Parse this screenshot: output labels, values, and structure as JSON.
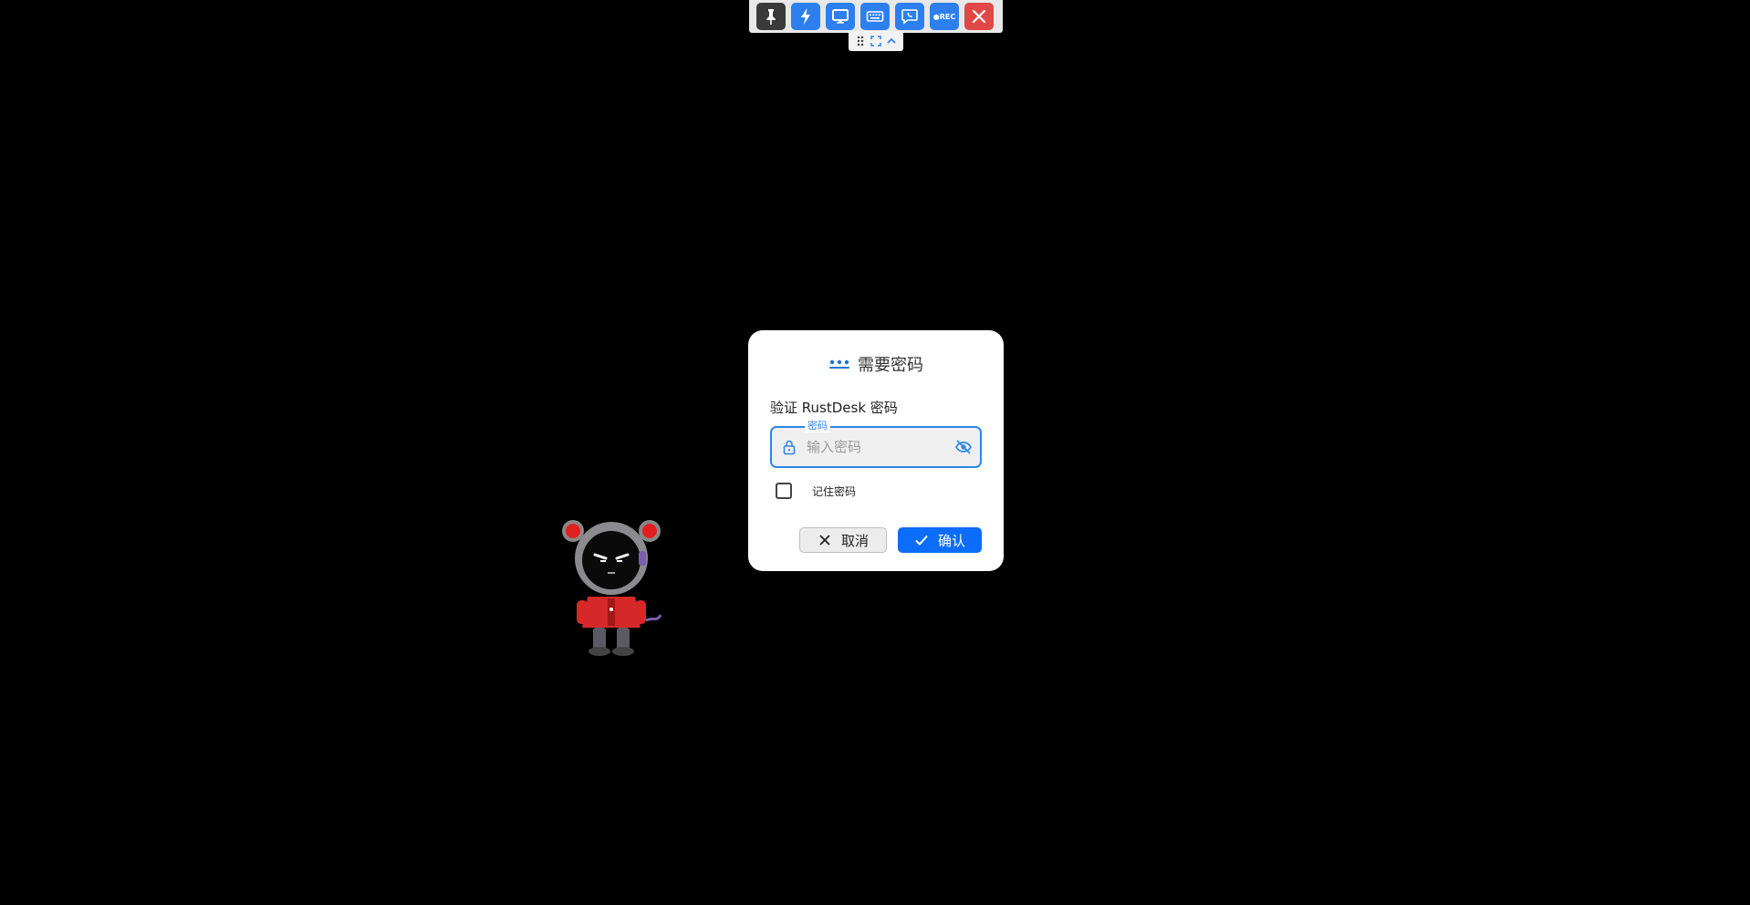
{
  "toolbar": {
    "buttons": [
      {
        "icon": "pin-icon",
        "color": "#3a3a3a"
      },
      {
        "icon": "lightning-icon",
        "color": "#2d7ff0"
      },
      {
        "icon": "monitor-icon",
        "color": "#2d7ff0"
      },
      {
        "icon": "keyboard-icon",
        "color": "#2d7ff0"
      },
      {
        "icon": "chat-icon",
        "color": "#2d7ff0"
      },
      {
        "icon": "record-icon",
        "color": "#2d7ff0"
      },
      {
        "icon": "close-icon",
        "color": "#e04848"
      }
    ],
    "rec_label": "●REC"
  },
  "subbar": {
    "icons": [
      "drag-handle-icon",
      "fullscreen-icon",
      "collapse-icon"
    ]
  },
  "dialog": {
    "title": "需要密码",
    "title_icon": "password-dots-icon",
    "subtitle": "验证 RustDesk 密码",
    "password_field": {
      "floating_label": "密码",
      "placeholder": "输入密码",
      "value": "",
      "accent": "#2c86e8"
    },
    "remember": {
      "label": "记住密码",
      "checked": false
    },
    "cancel_label": "取消",
    "confirm_label": "确认",
    "confirm_color": "#0b6dfa"
  },
  "background": "#000000"
}
